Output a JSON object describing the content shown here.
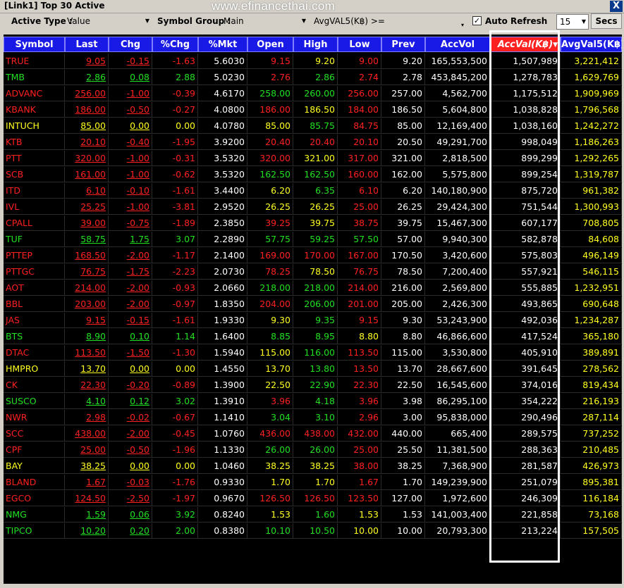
{
  "window": {
    "title": "[Link1] Top 30 Active",
    "watermark": "www.efinancethai.com",
    "close": "X"
  },
  "toolbar": {
    "active_type_label": "Active Type :",
    "active_type_value": "Value",
    "symbol_group_label": "Symbol Group :",
    "symbol_group_value": "Main",
    "filter_label": "AvgVAL5(K฿) >=",
    "auto_refresh_label": "Auto Refresh",
    "auto_refresh_checked": true,
    "interval_value": "15",
    "secs_label": "Secs"
  },
  "colors": {
    "up": "#20e020",
    "down": "#ff2020",
    "unchanged": "#ffff20",
    "header_bg": "#1a1ae6",
    "sorted_header_bg": "#ff2020"
  },
  "columns": [
    "Symbol",
    "Last",
    "Chg",
    "%Chg",
    "%Mkt",
    "Open",
    "High",
    "Low",
    "Prev",
    "AccVol",
    "AccVal(K฿)",
    "AvgVal5(K฿)"
  ],
  "sorted_column_index": 10,
  "rows": [
    {
      "sym": "TRUE",
      "last": "9.05",
      "chg": "-0.15",
      "pchg": "-1.63",
      "mkt": "5.6030",
      "open": "9.15",
      "high": "9.20",
      "low": "9.00",
      "prev": "9.20",
      "vol": "165,553,500",
      "val": "1,507,989",
      "avg": "3,221,412",
      "c": "down",
      "oc": "down",
      "hc": "unchanged",
      "lc": "down"
    },
    {
      "sym": "TMB",
      "last": "2.86",
      "chg": "0.08",
      "pchg": "2.88",
      "mkt": "5.0230",
      "open": "2.76",
      "high": "2.86",
      "low": "2.74",
      "prev": "2.78",
      "vol": "453,845,200",
      "val": "1,278,783",
      "avg": "1,629,769",
      "c": "up",
      "oc": "down",
      "hc": "up",
      "lc": "down"
    },
    {
      "sym": "ADVANC",
      "last": "256.00",
      "chg": "-1.00",
      "pchg": "-0.39",
      "mkt": "4.6170",
      "open": "258.00",
      "high": "260.00",
      "low": "256.00",
      "prev": "257.00",
      "vol": "4,562,700",
      "val": "1,175,512",
      "avg": "1,909,969",
      "c": "down",
      "oc": "up",
      "hc": "up",
      "lc": "down"
    },
    {
      "sym": "KBANK",
      "last": "186.00",
      "chg": "-0.50",
      "pchg": "-0.27",
      "mkt": "4.0800",
      "open": "186.00",
      "high": "186.50",
      "low": "184.00",
      "prev": "186.50",
      "vol": "5,604,800",
      "val": "1,038,828",
      "avg": "1,796,568",
      "c": "down",
      "oc": "down",
      "hc": "unchanged",
      "lc": "down"
    },
    {
      "sym": "INTUCH",
      "last": "85.00",
      "chg": "0.00",
      "pchg": "0.00",
      "mkt": "4.0780",
      "open": "85.00",
      "high": "85.75",
      "low": "84.75",
      "prev": "85.00",
      "vol": "12,169,400",
      "val": "1,038,160",
      "avg": "1,242,272",
      "c": "unchanged",
      "oc": "unchanged",
      "hc": "up",
      "lc": "down"
    },
    {
      "sym": "KTB",
      "last": "20.10",
      "chg": "-0.40",
      "pchg": "-1.95",
      "mkt": "3.9200",
      "open": "20.40",
      "high": "20.40",
      "low": "20.10",
      "prev": "20.50",
      "vol": "49,291,700",
      "val": "998,049",
      "avg": "1,186,263",
      "c": "down",
      "oc": "down",
      "hc": "down",
      "lc": "down"
    },
    {
      "sym": "PTT",
      "last": "320.00",
      "chg": "-1.00",
      "pchg": "-0.31",
      "mkt": "3.5320",
      "open": "320.00",
      "high": "321.00",
      "low": "317.00",
      "prev": "321.00",
      "vol": "2,818,500",
      "val": "899,299",
      "avg": "1,292,265",
      "c": "down",
      "oc": "down",
      "hc": "unchanged",
      "lc": "down"
    },
    {
      "sym": "SCB",
      "last": "161.00",
      "chg": "-1.00",
      "pchg": "-0.62",
      "mkt": "3.5320",
      "open": "162.50",
      "high": "162.50",
      "low": "160.00",
      "prev": "162.00",
      "vol": "5,575,800",
      "val": "899,254",
      "avg": "1,319,787",
      "c": "down",
      "oc": "up",
      "hc": "up",
      "lc": "down"
    },
    {
      "sym": "ITD",
      "last": "6.10",
      "chg": "-0.10",
      "pchg": "-1.61",
      "mkt": "3.4400",
      "open": "6.20",
      "high": "6.35",
      "low": "6.10",
      "prev": "6.20",
      "vol": "140,180,900",
      "val": "875,720",
      "avg": "961,382",
      "c": "down",
      "oc": "unchanged",
      "hc": "up",
      "lc": "down"
    },
    {
      "sym": "IVL",
      "last": "25.25",
      "chg": "-1.00",
      "pchg": "-3.81",
      "mkt": "2.9520",
      "open": "26.25",
      "high": "26.25",
      "low": "25.00",
      "prev": "26.25",
      "vol": "29,424,300",
      "val": "751,544",
      "avg": "1,300,993",
      "c": "down",
      "oc": "unchanged",
      "hc": "unchanged",
      "lc": "down"
    },
    {
      "sym": "CPALL",
      "last": "39.00",
      "chg": "-0.75",
      "pchg": "-1.89",
      "mkt": "2.3850",
      "open": "39.25",
      "high": "39.75",
      "low": "38.75",
      "prev": "39.75",
      "vol": "15,467,300",
      "val": "607,177",
      "avg": "708,805",
      "c": "down",
      "oc": "down",
      "hc": "unchanged",
      "lc": "down"
    },
    {
      "sym": "TUF",
      "last": "58.75",
      "chg": "1.75",
      "pchg": "3.07",
      "mkt": "2.2890",
      "open": "57.75",
      "high": "59.25",
      "low": "57.50",
      "prev": "57.00",
      "vol": "9,940,300",
      "val": "582,878",
      "avg": "84,608",
      "c": "up",
      "oc": "up",
      "hc": "up",
      "lc": "up"
    },
    {
      "sym": "PTTEP",
      "last": "168.50",
      "chg": "-2.00",
      "pchg": "-1.17",
      "mkt": "2.1400",
      "open": "169.00",
      "high": "170.00",
      "low": "167.00",
      "prev": "170.50",
      "vol": "3,420,600",
      "val": "575,803",
      "avg": "496,149",
      "c": "down",
      "oc": "down",
      "hc": "down",
      "lc": "down"
    },
    {
      "sym": "PTTGC",
      "last": "76.75",
      "chg": "-1.75",
      "pchg": "-2.23",
      "mkt": "2.0730",
      "open": "78.25",
      "high": "78.50",
      "low": "76.75",
      "prev": "78.50",
      "vol": "7,200,400",
      "val": "557,921",
      "avg": "546,115",
      "c": "down",
      "oc": "down",
      "hc": "unchanged",
      "lc": "down"
    },
    {
      "sym": "AOT",
      "last": "214.00",
      "chg": "-2.00",
      "pchg": "-0.93",
      "mkt": "2.0660",
      "open": "218.00",
      "high": "218.00",
      "low": "214.00",
      "prev": "216.00",
      "vol": "2,569,800",
      "val": "555,885",
      "avg": "1,232,951",
      "c": "down",
      "oc": "up",
      "hc": "up",
      "lc": "down"
    },
    {
      "sym": "BBL",
      "last": "203.00",
      "chg": "-2.00",
      "pchg": "-0.97",
      "mkt": "1.8350",
      "open": "204.00",
      "high": "206.00",
      "low": "201.00",
      "prev": "205.00",
      "vol": "2,426,300",
      "val": "493,865",
      "avg": "690,648",
      "c": "down",
      "oc": "down",
      "hc": "up",
      "lc": "down"
    },
    {
      "sym": "JAS",
      "last": "9.15",
      "chg": "-0.15",
      "pchg": "-1.61",
      "mkt": "1.9330",
      "open": "9.30",
      "high": "9.35",
      "low": "9.15",
      "prev": "9.30",
      "vol": "53,243,900",
      "val": "492,036",
      "avg": "1,234,287",
      "c": "down",
      "oc": "unchanged",
      "hc": "up",
      "lc": "down"
    },
    {
      "sym": "BTS",
      "last": "8.90",
      "chg": "0.10",
      "pchg": "1.14",
      "mkt": "1.6400",
      "open": "8.85",
      "high": "8.95",
      "low": "8.80",
      "prev": "8.80",
      "vol": "46,866,600",
      "val": "417,524",
      "avg": "365,180",
      "c": "up",
      "oc": "up",
      "hc": "up",
      "lc": "unchanged"
    },
    {
      "sym": "DTAC",
      "last": "113.50",
      "chg": "-1.50",
      "pchg": "-1.30",
      "mkt": "1.5940",
      "open": "115.00",
      "high": "116.00",
      "low": "113.50",
      "prev": "115.00",
      "vol": "3,530,800",
      "val": "405,910",
      "avg": "389,891",
      "c": "down",
      "oc": "unchanged",
      "hc": "up",
      "lc": "down"
    },
    {
      "sym": "HMPRO",
      "last": "13.70",
      "chg": "0.00",
      "pchg": "0.00",
      "mkt": "1.4550",
      "open": "13.70",
      "high": "13.80",
      "low": "13.50",
      "prev": "13.70",
      "vol": "28,667,600",
      "val": "391,645",
      "avg": "278,562",
      "c": "unchanged",
      "oc": "unchanged",
      "hc": "up",
      "lc": "down"
    },
    {
      "sym": "CK",
      "last": "22.30",
      "chg": "-0.20",
      "pchg": "-0.89",
      "mkt": "1.3900",
      "open": "22.50",
      "high": "22.90",
      "low": "22.30",
      "prev": "22.50",
      "vol": "16,545,600",
      "val": "374,016",
      "avg": "819,434",
      "c": "down",
      "oc": "unchanged",
      "hc": "up",
      "lc": "down"
    },
    {
      "sym": "SUSCO",
      "last": "4.10",
      "chg": "0.12",
      "pchg": "3.02",
      "mkt": "1.3910",
      "open": "3.96",
      "high": "4.18",
      "low": "3.96",
      "prev": "3.98",
      "vol": "86,295,100",
      "val": "354,222",
      "avg": "216,193",
      "c": "up",
      "oc": "down",
      "hc": "up",
      "lc": "down"
    },
    {
      "sym": "NWR",
      "last": "2.98",
      "chg": "-0.02",
      "pchg": "-0.67",
      "mkt": "1.1410",
      "open": "3.04",
      "high": "3.10",
      "low": "2.96",
      "prev": "3.00",
      "vol": "95,838,000",
      "val": "290,496",
      "avg": "287,114",
      "c": "down",
      "oc": "up",
      "hc": "up",
      "lc": "down"
    },
    {
      "sym": "SCC",
      "last": "438.00",
      "chg": "-2.00",
      "pchg": "-0.45",
      "mkt": "1.0760",
      "open": "436.00",
      "high": "438.00",
      "low": "432.00",
      "prev": "440.00",
      "vol": "665,400",
      "val": "289,575",
      "avg": "737,252",
      "c": "down",
      "oc": "down",
      "hc": "down",
      "lc": "down"
    },
    {
      "sym": "CPF",
      "last": "25.00",
      "chg": "-0.50",
      "pchg": "-1.96",
      "mkt": "1.1330",
      "open": "26.00",
      "high": "26.00",
      "low": "25.00",
      "prev": "25.50",
      "vol": "11,381,500",
      "val": "288,363",
      "avg": "210,485",
      "c": "down",
      "oc": "up",
      "hc": "up",
      "lc": "down"
    },
    {
      "sym": "BAY",
      "last": "38.25",
      "chg": "0.00",
      "pchg": "0.00",
      "mkt": "1.0460",
      "open": "38.25",
      "high": "38.25",
      "low": "38.00",
      "prev": "38.25",
      "vol": "7,368,900",
      "val": "281,587",
      "avg": "426,973",
      "c": "unchanged",
      "oc": "unchanged",
      "hc": "unchanged",
      "lc": "down"
    },
    {
      "sym": "BLAND",
      "last": "1.67",
      "chg": "-0.03",
      "pchg": "-1.76",
      "mkt": "0.9330",
      "open": "1.70",
      "high": "1.70",
      "low": "1.67",
      "prev": "1.70",
      "vol": "149,239,900",
      "val": "251,079",
      "avg": "895,381",
      "c": "down",
      "oc": "unchanged",
      "hc": "unchanged",
      "lc": "down"
    },
    {
      "sym": "EGCO",
      "last": "124.50",
      "chg": "-2.50",
      "pchg": "-1.97",
      "mkt": "0.9670",
      "open": "126.50",
      "high": "126.50",
      "low": "123.50",
      "prev": "127.00",
      "vol": "1,972,600",
      "val": "246,309",
      "avg": "116,184",
      "c": "down",
      "oc": "down",
      "hc": "down",
      "lc": "down"
    },
    {
      "sym": "NMG",
      "last": "1.59",
      "chg": "0.06",
      "pchg": "3.92",
      "mkt": "0.8240",
      "open": "1.53",
      "high": "1.60",
      "low": "1.53",
      "prev": "1.53",
      "vol": "141,003,400",
      "val": "221,858",
      "avg": "73,168",
      "c": "up",
      "oc": "unchanged",
      "hc": "up",
      "lc": "unchanged"
    },
    {
      "sym": "TIPCO",
      "last": "10.20",
      "chg": "0.20",
      "pchg": "2.00",
      "mkt": "0.8380",
      "open": "10.10",
      "high": "10.50",
      "low": "10.00",
      "prev": "10.00",
      "vol": "20,793,300",
      "val": "213,224",
      "avg": "157,505",
      "c": "up",
      "oc": "up",
      "hc": "up",
      "lc": "unchanged"
    }
  ]
}
